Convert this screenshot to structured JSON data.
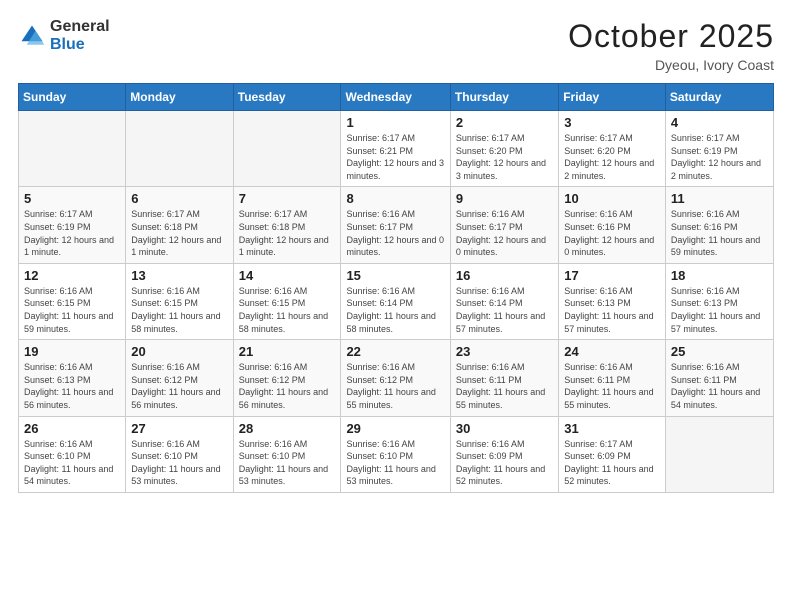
{
  "logo": {
    "general": "General",
    "blue": "Blue"
  },
  "title": {
    "month": "October 2025",
    "location": "Dyeou, Ivory Coast"
  },
  "weekdays": [
    "Sunday",
    "Monday",
    "Tuesday",
    "Wednesday",
    "Thursday",
    "Friday",
    "Saturday"
  ],
  "weeks": [
    [
      {
        "day": "",
        "info": ""
      },
      {
        "day": "",
        "info": ""
      },
      {
        "day": "",
        "info": ""
      },
      {
        "day": "1",
        "info": "Sunrise: 6:17 AM\nSunset: 6:21 PM\nDaylight: 12 hours and 3 minutes."
      },
      {
        "day": "2",
        "info": "Sunrise: 6:17 AM\nSunset: 6:20 PM\nDaylight: 12 hours and 3 minutes."
      },
      {
        "day": "3",
        "info": "Sunrise: 6:17 AM\nSunset: 6:20 PM\nDaylight: 12 hours and 2 minutes."
      },
      {
        "day": "4",
        "info": "Sunrise: 6:17 AM\nSunset: 6:19 PM\nDaylight: 12 hours and 2 minutes."
      }
    ],
    [
      {
        "day": "5",
        "info": "Sunrise: 6:17 AM\nSunset: 6:19 PM\nDaylight: 12 hours and 1 minute."
      },
      {
        "day": "6",
        "info": "Sunrise: 6:17 AM\nSunset: 6:18 PM\nDaylight: 12 hours and 1 minute."
      },
      {
        "day": "7",
        "info": "Sunrise: 6:17 AM\nSunset: 6:18 PM\nDaylight: 12 hours and 1 minute."
      },
      {
        "day": "8",
        "info": "Sunrise: 6:16 AM\nSunset: 6:17 PM\nDaylight: 12 hours and 0 minutes."
      },
      {
        "day": "9",
        "info": "Sunrise: 6:16 AM\nSunset: 6:17 PM\nDaylight: 12 hours and 0 minutes."
      },
      {
        "day": "10",
        "info": "Sunrise: 6:16 AM\nSunset: 6:16 PM\nDaylight: 12 hours and 0 minutes."
      },
      {
        "day": "11",
        "info": "Sunrise: 6:16 AM\nSunset: 6:16 PM\nDaylight: 11 hours and 59 minutes."
      }
    ],
    [
      {
        "day": "12",
        "info": "Sunrise: 6:16 AM\nSunset: 6:15 PM\nDaylight: 11 hours and 59 minutes."
      },
      {
        "day": "13",
        "info": "Sunrise: 6:16 AM\nSunset: 6:15 PM\nDaylight: 11 hours and 58 minutes."
      },
      {
        "day": "14",
        "info": "Sunrise: 6:16 AM\nSunset: 6:15 PM\nDaylight: 11 hours and 58 minutes."
      },
      {
        "day": "15",
        "info": "Sunrise: 6:16 AM\nSunset: 6:14 PM\nDaylight: 11 hours and 58 minutes."
      },
      {
        "day": "16",
        "info": "Sunrise: 6:16 AM\nSunset: 6:14 PM\nDaylight: 11 hours and 57 minutes."
      },
      {
        "day": "17",
        "info": "Sunrise: 6:16 AM\nSunset: 6:13 PM\nDaylight: 11 hours and 57 minutes."
      },
      {
        "day": "18",
        "info": "Sunrise: 6:16 AM\nSunset: 6:13 PM\nDaylight: 11 hours and 57 minutes."
      }
    ],
    [
      {
        "day": "19",
        "info": "Sunrise: 6:16 AM\nSunset: 6:13 PM\nDaylight: 11 hours and 56 minutes."
      },
      {
        "day": "20",
        "info": "Sunrise: 6:16 AM\nSunset: 6:12 PM\nDaylight: 11 hours and 56 minutes."
      },
      {
        "day": "21",
        "info": "Sunrise: 6:16 AM\nSunset: 6:12 PM\nDaylight: 11 hours and 56 minutes."
      },
      {
        "day": "22",
        "info": "Sunrise: 6:16 AM\nSunset: 6:12 PM\nDaylight: 11 hours and 55 minutes."
      },
      {
        "day": "23",
        "info": "Sunrise: 6:16 AM\nSunset: 6:11 PM\nDaylight: 11 hours and 55 minutes."
      },
      {
        "day": "24",
        "info": "Sunrise: 6:16 AM\nSunset: 6:11 PM\nDaylight: 11 hours and 55 minutes."
      },
      {
        "day": "25",
        "info": "Sunrise: 6:16 AM\nSunset: 6:11 PM\nDaylight: 11 hours and 54 minutes."
      }
    ],
    [
      {
        "day": "26",
        "info": "Sunrise: 6:16 AM\nSunset: 6:10 PM\nDaylight: 11 hours and 54 minutes."
      },
      {
        "day": "27",
        "info": "Sunrise: 6:16 AM\nSunset: 6:10 PM\nDaylight: 11 hours and 53 minutes."
      },
      {
        "day": "28",
        "info": "Sunrise: 6:16 AM\nSunset: 6:10 PM\nDaylight: 11 hours and 53 minutes."
      },
      {
        "day": "29",
        "info": "Sunrise: 6:16 AM\nSunset: 6:10 PM\nDaylight: 11 hours and 53 minutes."
      },
      {
        "day": "30",
        "info": "Sunrise: 6:16 AM\nSunset: 6:09 PM\nDaylight: 11 hours and 52 minutes."
      },
      {
        "day": "31",
        "info": "Sunrise: 6:17 AM\nSunset: 6:09 PM\nDaylight: 11 hours and 52 minutes."
      },
      {
        "day": "",
        "info": ""
      }
    ]
  ]
}
